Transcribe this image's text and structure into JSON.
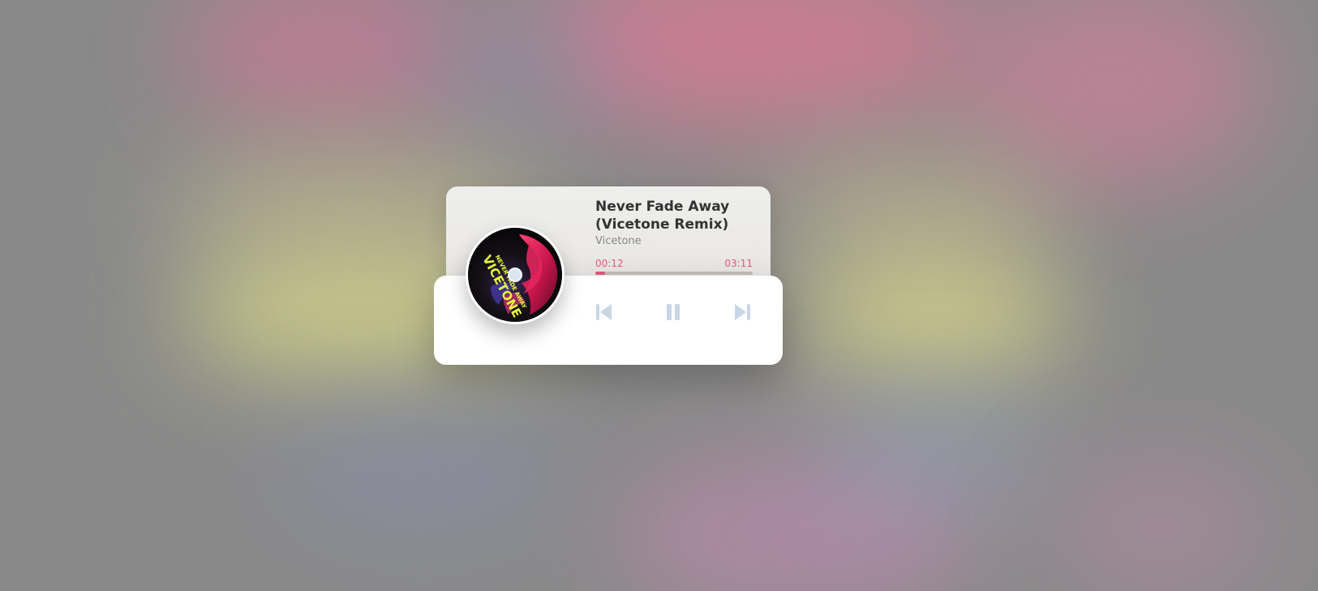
{
  "track": {
    "title": "Never Fade Away (Vicetone Remix)",
    "artist": "Vicetone",
    "current_time": "00:12",
    "duration": "03:11",
    "progress_percent": 6.3
  },
  "artwork": {
    "small_text": "NEVER FADE AWAY",
    "big_text": "VICETONE"
  },
  "colors": {
    "accent": "#df5a82",
    "control_icon": "#c8d6e5"
  },
  "controls": {
    "previous_icon": "skip-back-icon",
    "play_pause_icon": "pause-icon",
    "next_icon": "skip-forward-icon"
  }
}
